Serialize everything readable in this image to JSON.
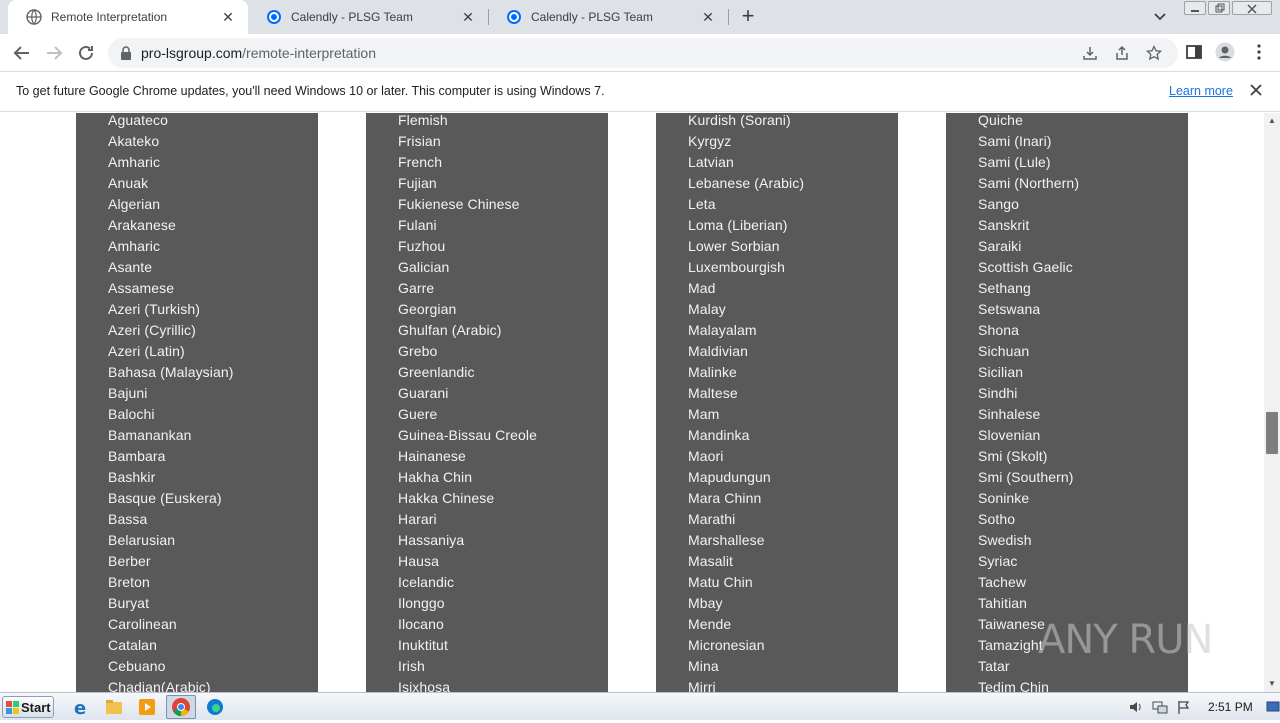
{
  "browser": {
    "tabs": [
      {
        "title": "Remote Interpretation",
        "active": true
      },
      {
        "title": "Calendly - PLSG Team",
        "active": false
      },
      {
        "title": "Calendly - PLSG Team",
        "active": false
      }
    ],
    "url_host": "pro-lsgroup.com",
    "url_path": "/remote-interpretation"
  },
  "infobar": {
    "message": "To get future Google Chrome updates, you'll need Windows 10 or later. This computer is using Windows 7.",
    "link": "Learn more"
  },
  "languages": {
    "col1": [
      "Aguateco",
      "Akateko",
      "Amharic",
      "Anuak",
      "Algerian",
      "Arakanese",
      "Amharic",
      "Asante",
      "Assamese",
      "Azeri (Turkish)",
      "Azeri (Cyrillic)",
      "Azeri (Latin)",
      "Bahasa (Malaysian)",
      "Bajuni",
      "Balochi",
      "Bamanankan",
      "Bambara",
      "Bashkir",
      "Basque (Euskera)",
      "Bassa",
      "Belarusian",
      "Berber",
      "Breton",
      "Buryat",
      "Carolinean",
      "Catalan",
      "Cebuano",
      "Chadian(Arabic)"
    ],
    "col2": [
      "Flemish",
      "Frisian",
      "French",
      "Fujian",
      "Fukienese Chinese",
      "Fulani",
      "Fuzhou",
      "Galician",
      "Garre",
      "Georgian",
      "Ghulfan (Arabic)",
      "Grebo",
      "Greenlandic",
      "Guarani",
      "Guere",
      "Guinea-Bissau Creole",
      "Hainanese",
      "Hakha Chin",
      "Hakka Chinese",
      "Harari",
      "Hassaniya",
      "Hausa",
      "Icelandic",
      "Ilonggo",
      "Ilocano",
      "Inuktitut",
      "Irish",
      "Isixhosa"
    ],
    "col3": [
      "Kurdish (Sorani)",
      "Kyrgyz",
      "Latvian",
      "Lebanese (Arabic)",
      "Leta",
      "Loma (Liberian)",
      "Lower Sorbian",
      "Luxembourgish",
      "Mad",
      "Malay",
      "Malayalam",
      "Maldivian",
      "Malinke",
      "Maltese",
      "Mam",
      "Mandinka",
      "Maori",
      "Mapudungun",
      "Mara Chinn",
      "Marathi",
      "Marshallese",
      "Masalit",
      "Matu Chin",
      "Mbay",
      "Mende",
      "Micronesian",
      "Mina",
      "Mirri"
    ],
    "col4": [
      "Quiche",
      "Sami (Inari)",
      "Sami (Lule)",
      "Sami (Northern)",
      "Sango",
      "Sanskrit",
      "Saraiki",
      "Scottish Gaelic",
      "Sethang",
      "Setswana",
      "Shona",
      "Sichuan",
      "Sicilian",
      "Sindhi",
      "Sinhalese",
      "Slovenian",
      "Smi (Skolt)",
      "Smi (Southern)",
      "Soninke",
      "Sotho",
      "Swedish",
      "Syriac",
      "Tachew",
      "Tahitian",
      "Taiwanese",
      "Tamazight",
      "Tatar",
      "Tedim Chin"
    ]
  },
  "watermark": "ANY RUN",
  "taskbar": {
    "start_label": "Start",
    "clock": "2:51 PM"
  },
  "colors": {
    "column_bg": "#595959",
    "column_text": "#f2f2f2",
    "link": "#1a73e8"
  }
}
